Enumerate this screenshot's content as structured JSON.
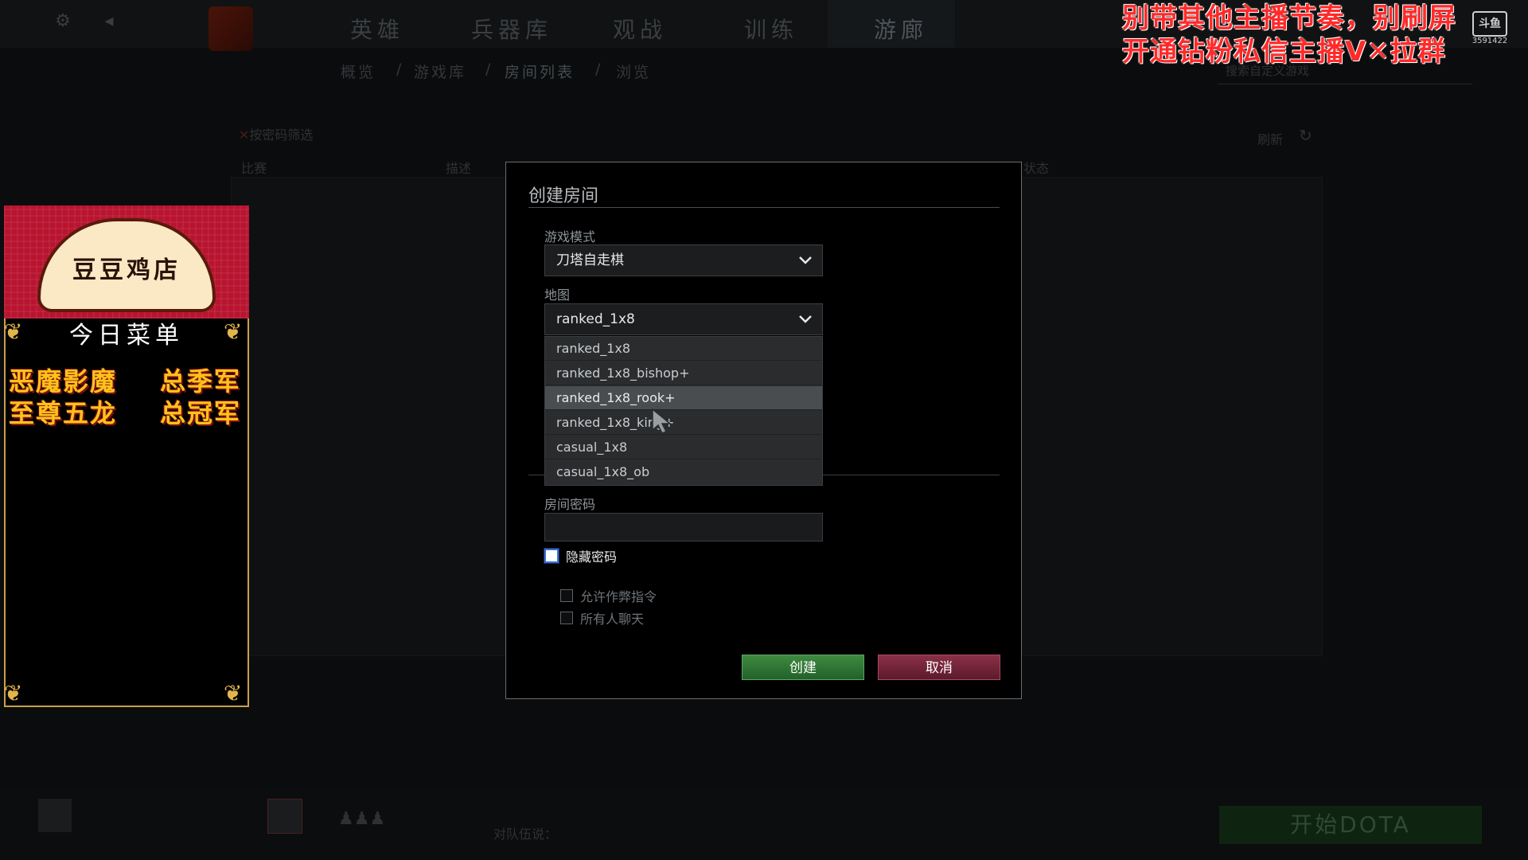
{
  "background": {
    "nav": [
      "英雄",
      "兵器库",
      "观战",
      "训练",
      "游廊"
    ],
    "breadcrumb": [
      "概览",
      "/",
      "游戏库",
      "/",
      "房间列表",
      "/",
      "浏览"
    ],
    "search_placeholder": "搜索自定义游戏",
    "filter_label": "按密码筛选",
    "refresh_label": "刷新",
    "list_columns": [
      "比赛",
      "描述",
      "状态"
    ],
    "party_hint": "对队伍说：",
    "start_button": "开始DOTA"
  },
  "overlay": {
    "banner_lines": [
      "别带其他主播节奏，别刷屏",
      "开通钻粉私信主播V✕拉群"
    ],
    "platform_badge": {
      "logo": "斗鱼",
      "room_id": "3591422"
    },
    "menu": {
      "shop_name": "豆豆鸡店",
      "title": "今日菜单",
      "items": [
        "恶魔影魔",
        "总季军",
        "至尊五龙",
        "总冠军"
      ]
    }
  },
  "dialog": {
    "title": "创建房间",
    "game_mode_label": "游戏模式",
    "game_mode_value": "刀塔自走棋",
    "map_label": "地图",
    "map_value": "ranked_1x8",
    "map_options": [
      "ranked_1x8",
      "ranked_1x8_bishop+",
      "ranked_1x8_rook+",
      "ranked_1x8_king+",
      "casual_1x8",
      "casual_1x8_ob"
    ],
    "map_hover_index": 2,
    "password_label": "房间密码",
    "password_value": "",
    "hide_password_label": "隐藏密码",
    "allow_cheats_label": "允许作弊指令",
    "all_chat_label": "所有人聊天",
    "create_label": "创建",
    "cancel_label": "取消"
  },
  "colors": {
    "create_green": "#2f7a34",
    "cancel_red": "#7a2438",
    "banner_red": "#ff2a2a",
    "menu_gold": "#ffc21a"
  }
}
